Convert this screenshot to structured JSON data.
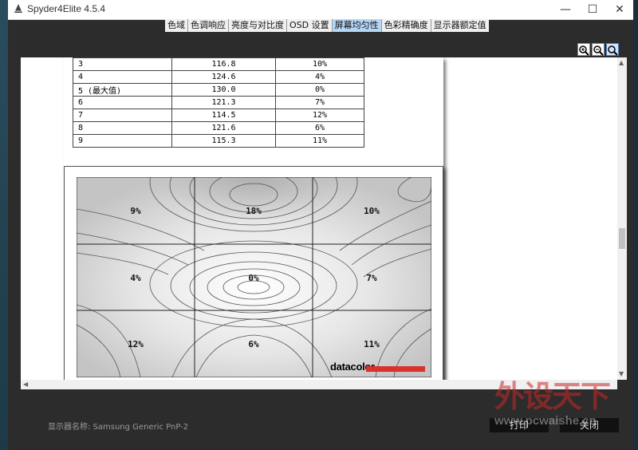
{
  "window": {
    "title": "Spyder4Elite 4.5.4"
  },
  "window_controls": {
    "minimize": "—",
    "maximize": "☐",
    "close": "✕"
  },
  "tabs": [
    {
      "label": "色域",
      "active": false
    },
    {
      "label": "色调响应",
      "active": false
    },
    {
      "label": "亮度与对比度",
      "active": false
    },
    {
      "label": "OSD 设置",
      "active": false
    },
    {
      "label": "屏幕均匀性",
      "active": true
    },
    {
      "label": "色彩精确度",
      "active": false
    },
    {
      "label": "显示器额定值",
      "active": false
    }
  ],
  "zoom_tools": {
    "icons": [
      "zoom-in-icon",
      "zoom-out-icon",
      "zoom-actual-icon"
    ]
  },
  "report": {
    "table_rows": [
      {
        "zone": "3",
        "luminance": "116.8",
        "deviation": "10%"
      },
      {
        "zone": "4",
        "luminance": "124.6",
        "deviation": "4%"
      },
      {
        "zone": "5 (最大值)",
        "luminance": "130.0",
        "deviation": "0%"
      },
      {
        "zone": "6",
        "luminance": "121.3",
        "deviation": "7%"
      },
      {
        "zone": "7",
        "luminance": "114.5",
        "deviation": "12%"
      },
      {
        "zone": "8",
        "luminance": "121.6",
        "deviation": "6%"
      },
      {
        "zone": "9",
        "luminance": "115.3",
        "deviation": "11%"
      }
    ],
    "uniformity_map": {
      "labels": [
        "9%",
        "18%",
        "10%",
        "4%",
        "0%",
        "7%",
        "12%",
        "6%",
        "11%"
      ]
    },
    "brand": "datacolor",
    "brand_color": "#d9322b"
  },
  "footer": {
    "display_name": "显示器名称: Samsung Generic PnP-2",
    "print_label": "打印",
    "close_label": "关闭"
  },
  "watermark": {
    "text": "外设天下",
    "url": "www.pcwaishe.cn"
  }
}
